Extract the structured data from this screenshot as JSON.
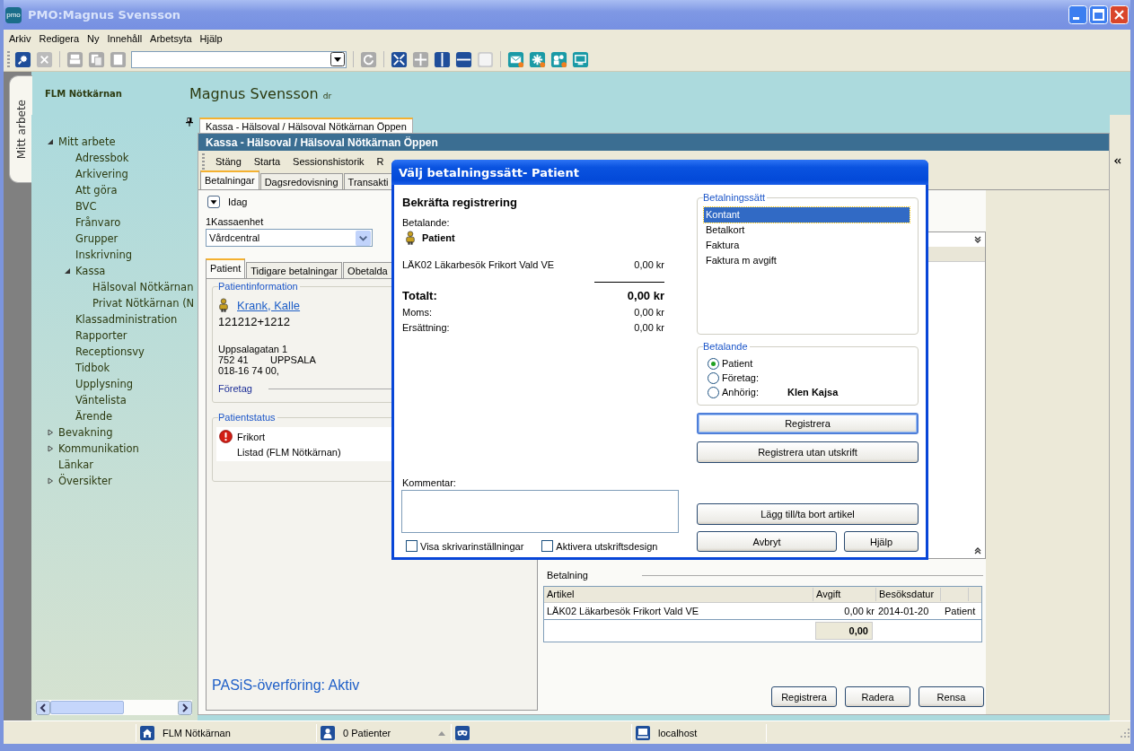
{
  "window": {
    "title": "PMO:Magnus Svensson",
    "logo": "pmo"
  },
  "menu": [
    "Arkiv",
    "Redigera",
    "Ny",
    "Innehåll",
    "Arbetsyta",
    "Hjälp"
  ],
  "side_tab": {
    "label": "Mitt arbete"
  },
  "header": {
    "unit": "FLM Nötkärnan",
    "user": "Magnus Svensson",
    "suffix": "dr"
  },
  "tree": [
    {
      "label": "Mitt arbete",
      "expanded": true,
      "children": [
        {
          "label": "Adressbok"
        },
        {
          "label": "Arkivering"
        },
        {
          "label": "Att göra"
        },
        {
          "label": "BVC"
        },
        {
          "label": "Frånvaro"
        },
        {
          "label": "Grupper"
        },
        {
          "label": "Inskrivning"
        },
        {
          "label": "Kassa",
          "expanded": true,
          "children": [
            {
              "label": "Hälsoval Nötkärnan"
            },
            {
              "label": "Privat Nötkärnan (N"
            }
          ]
        },
        {
          "label": "Klassadministration"
        },
        {
          "label": "Rapporter"
        },
        {
          "label": "Receptionsvy"
        },
        {
          "label": "Tidbok"
        },
        {
          "label": "Upplysning"
        },
        {
          "label": "Väntelista"
        },
        {
          "label": "Ärende"
        }
      ]
    },
    {
      "label": "Bevakning",
      "expanded": false
    },
    {
      "label": "Kommunikation",
      "expanded": false
    },
    {
      "label": "Länkar"
    },
    {
      "label": "Översikter",
      "expanded": false
    }
  ],
  "document": {
    "tab": "Kassa - Hälsoval / Hälsoval Nötkärnan Öppen",
    "title": "Kassa - Hälsoval / Hälsoval Nötkärnan Öppen",
    "toolbar": [
      "Stäng",
      "Starta",
      "Sessionshistorik",
      "R"
    ],
    "tabs": [
      {
        "label": "Betalningar",
        "selected": true
      },
      {
        "label": "Dagsredovisning",
        "selected": false
      },
      {
        "label": "Transakti",
        "selected": false
      }
    ],
    "period": "Idag",
    "unit_label": "1Kassaenhet",
    "unit_value": "Vårdcentral",
    "patient_tabs": [
      {
        "label": "Patient",
        "selected": true
      },
      {
        "label": "Tidigare betalningar",
        "selected": false
      },
      {
        "label": "Obetalda",
        "selected": false
      }
    ],
    "patient_info": {
      "legend": "Patientinformation",
      "name": "Krank, Kalle",
      "id": "121212+1212",
      "street": "Uppsalagatan 1",
      "postcode": "752 41",
      "city": "UPPSALA",
      "phone": "018-16 74 00,",
      "company_label": "Företag"
    },
    "patient_status": {
      "legend": "Patientstatus",
      "items": [
        {
          "label": "Frikort",
          "alert": true
        },
        {
          "label": "Listad (FLM Nötkärnan)",
          "alert": false
        }
      ]
    },
    "pasis": "PASiS-överföring: Aktiv",
    "payment": {
      "label": "Betalning",
      "columns": [
        "Artikel",
        "Avgift",
        "Besöksdatur"
      ],
      "rows": [
        [
          "LÄK02 Läkarbesök Frikort Vald VE",
          "0,00 kr",
          "2014-01-20",
          "Patient"
        ]
      ],
      "total": "0,00"
    },
    "buttons": [
      "Registrera",
      "Radera",
      "Rensa"
    ]
  },
  "dialog": {
    "title": "Välj betalningssätt- Patient",
    "heading": "Bekräfta registrering",
    "payer_label": "Betalande:",
    "payer": "Patient",
    "lines": [
      {
        "label": "LÄK02 Läkarbesök Frikort Vald VE",
        "amount": "0,00 kr"
      }
    ],
    "total_label": "Totalt:",
    "total": "0,00 kr",
    "summary": [
      {
        "label": "Moms:",
        "amount": "0,00 kr"
      },
      {
        "label": "Ersättning:",
        "amount": "0,00 kr"
      }
    ],
    "comment_label": "Kommentar:",
    "options": [
      {
        "label": "Visa skrivarinställningar",
        "checked": false
      },
      {
        "label": "Aktivera utskriftsdesign",
        "checked": false
      }
    ],
    "methods_legend": "Betalningssätt",
    "methods": [
      {
        "label": "Kontant",
        "selected": true
      },
      {
        "label": "Betalkort",
        "selected": false
      },
      {
        "label": "Faktura",
        "selected": false
      },
      {
        "label": "Faktura m avgift",
        "selected": false
      }
    ],
    "payer_legend": "Betalande",
    "payers": [
      {
        "label": "Patient",
        "selected": true
      },
      {
        "label": "Företag:",
        "selected": false
      },
      {
        "label": "Anhörig:",
        "selected": false,
        "name": "Klen Kajsa"
      }
    ],
    "actions": [
      {
        "label": "Registrera",
        "default": true
      },
      {
        "label": "Registrera utan utskrift",
        "default": false
      },
      {
        "label": "Lägg till/ta bort artikel",
        "default": false
      },
      {
        "label": "Avbryt",
        "default": false
      },
      {
        "label": "Hjälp",
        "default": false
      }
    ]
  },
  "status_bar": {
    "unit": "FLM Nötkärnan",
    "patients": "0 Patienter",
    "host": "localhost"
  }
}
